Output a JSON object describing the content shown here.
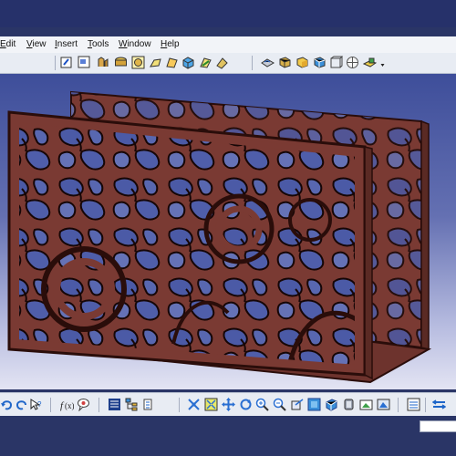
{
  "menu": {
    "items": [
      "Edit",
      "View",
      "Insert",
      "Tools",
      "Window",
      "Help"
    ]
  },
  "toolbar_top": {
    "icons": [
      "sketch-icon",
      "drafting-icon",
      "pad-icon",
      "pocket-icon",
      "shaft-icon",
      "fillet-icon",
      "draft-icon",
      "shell-icon",
      "measure-icon",
      "material-icon",
      "apply-material-icon",
      "render-style-icon",
      "shading-icon",
      "box-icon",
      "edge-icon",
      "hide-show-icon",
      "compass-icon",
      "analysis-icon"
    ]
  },
  "toolbar_bottom": {
    "icons": [
      "undo-icon",
      "redo-icon",
      "whats-this-icon",
      "formula-icon",
      "knowledge-icon",
      "list-icon",
      "tree-icon",
      "properties-icon",
      "fly-icon",
      "fit-all-icon",
      "pan-icon",
      "rotate-icon",
      "zoom-in-icon",
      "zoom-out-icon",
      "normal-view-icon",
      "iso-view-icon",
      "render-icon",
      "hide-icon",
      "swap-icon",
      "capture-icon",
      "exit-icon"
    ]
  },
  "colors": {
    "model_fill": "#7a3a33",
    "model_edge": "#2a0d0a",
    "background_top": "#3e4e9a",
    "background_bottom": "#e3e4f3"
  }
}
